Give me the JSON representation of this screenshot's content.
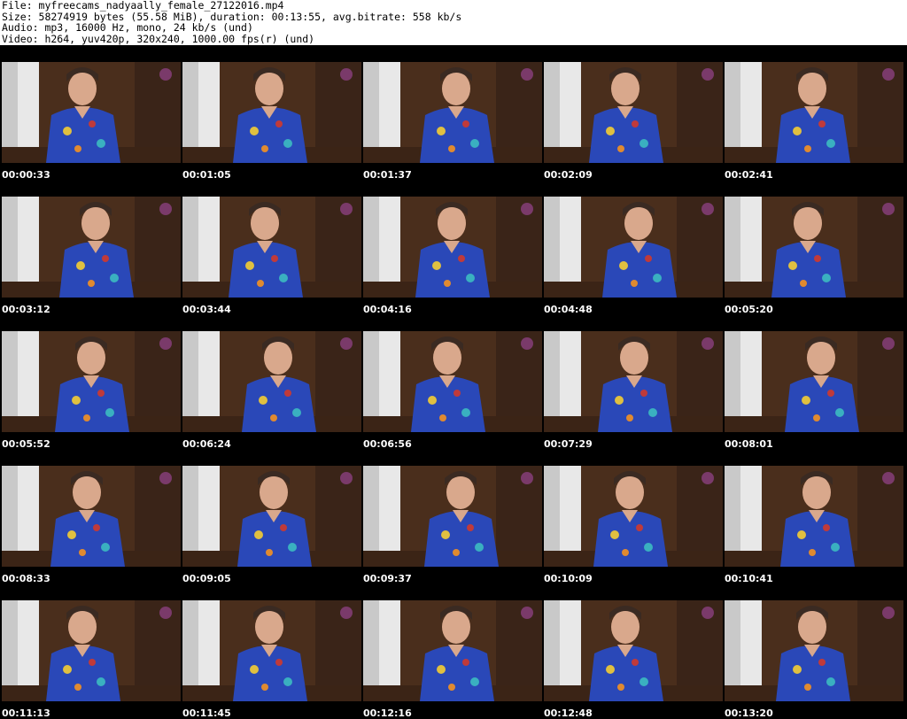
{
  "header": {
    "line1": "File: myfreecams_nadyaally_female_27122016.mp4",
    "line2": "Size: 58274919 bytes (55.58 MiB), duration: 00:13:55, avg.bitrate: 558 kb/s",
    "line3": "Audio: mp3, 16000 Hz, mono, 24 kb/s (und)",
    "line4": "Video: h264, yuv420p, 320x240, 1000.00 fps(r) (und)"
  },
  "colors": {
    "background": "#000000",
    "header_bg": "#ffffff",
    "dress": "#2a48b8",
    "wall": "#c9c9c9",
    "wood": "#4a2e1c"
  },
  "thumbnails": [
    {
      "time": "00:00:33"
    },
    {
      "time": "00:01:05"
    },
    {
      "time": "00:01:37"
    },
    {
      "time": "00:02:09"
    },
    {
      "time": "00:02:41"
    },
    {
      "time": "00:03:12"
    },
    {
      "time": "00:03:44"
    },
    {
      "time": "00:04:16"
    },
    {
      "time": "00:04:48"
    },
    {
      "time": "00:05:20"
    },
    {
      "time": "00:05:52"
    },
    {
      "time": "00:06:24"
    },
    {
      "time": "00:06:56"
    },
    {
      "time": "00:07:29"
    },
    {
      "time": "00:08:01"
    },
    {
      "time": "00:08:33"
    },
    {
      "time": "00:09:05"
    },
    {
      "time": "00:09:37"
    },
    {
      "time": "00:10:09"
    },
    {
      "time": "00:10:41"
    },
    {
      "time": "00:11:13"
    },
    {
      "time": "00:11:45"
    },
    {
      "time": "00:12:16"
    },
    {
      "time": "00:12:48"
    },
    {
      "time": "00:13:20"
    }
  ]
}
